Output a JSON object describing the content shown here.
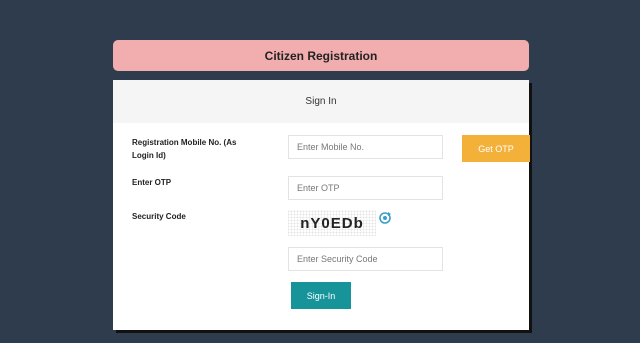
{
  "header": {
    "title": "Citizen Registration"
  },
  "card": {
    "heading": "Sign In",
    "mobile": {
      "label": "Registration Mobile No. (As Login Id)",
      "placeholder": "Enter Mobile No.",
      "button": "Get OTP"
    },
    "otp": {
      "label": "Enter OTP",
      "placeholder": "Enter OTP"
    },
    "security": {
      "label": "Security Code",
      "captcha_text": "nY0EDb",
      "placeholder": "Enter Security Code"
    },
    "submit": "Sign-In"
  },
  "colors": {
    "background": "#2f3c4d",
    "header": "#f2aeae",
    "otp_button": "#f4b13a",
    "signin_button": "#17949a",
    "refresh_icon": "#3aa0c8"
  },
  "icons": {
    "refresh": "refresh-icon"
  }
}
